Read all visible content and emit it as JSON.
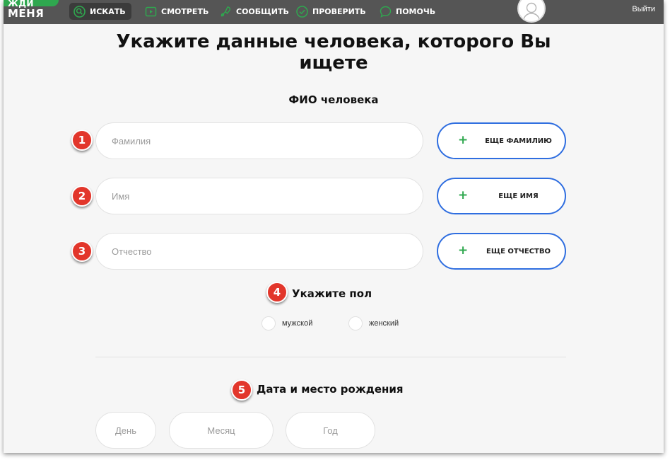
{
  "header": {
    "logo_line1": "ЖДИ",
    "logo_line2": "МЕНЯ",
    "nav": [
      {
        "label": "ИСКАТЬ",
        "icon": "search-icon"
      },
      {
        "label": "СМОТРЕТЬ",
        "icon": "video-icon"
      },
      {
        "label": "СООБЩИТЬ",
        "icon": "map-pin-icon"
      },
      {
        "label": "ПРОВЕРИТЬ",
        "icon": "check-icon"
      },
      {
        "label": "ПОМОЧЬ",
        "icon": "chat-icon"
      }
    ],
    "logout_label": "Выйти"
  },
  "form": {
    "title_line1": "Укажите данные человека, которого Вы",
    "title_line2": "ищете",
    "name_section_title": "ФИО человека",
    "fields": [
      {
        "badge": "1",
        "placeholder": "Фамилия",
        "add_label": "ЕЩЕ ФАМИЛИЮ"
      },
      {
        "badge": "2",
        "placeholder": "Имя",
        "add_label": "ЕЩЕ ИМЯ"
      },
      {
        "badge": "3",
        "placeholder": "Отчество",
        "add_label": "ЕЩЕ ОТЧЕСТВО"
      }
    ],
    "gender": {
      "badge": "4",
      "title": "Укажите пол",
      "options": [
        "мужской",
        "женский"
      ]
    },
    "birth": {
      "badge": "5",
      "title": "Дата и место рождения",
      "day_placeholder": "День",
      "month_placeholder": "Месяц",
      "year_placeholder": "Год"
    },
    "add_symbol": "+"
  },
  "colors": {
    "header_bg": "#555555",
    "brand_green": "#2fa84f",
    "button_border_blue": "#2f6ee0",
    "badge_red": "#e2362b"
  }
}
